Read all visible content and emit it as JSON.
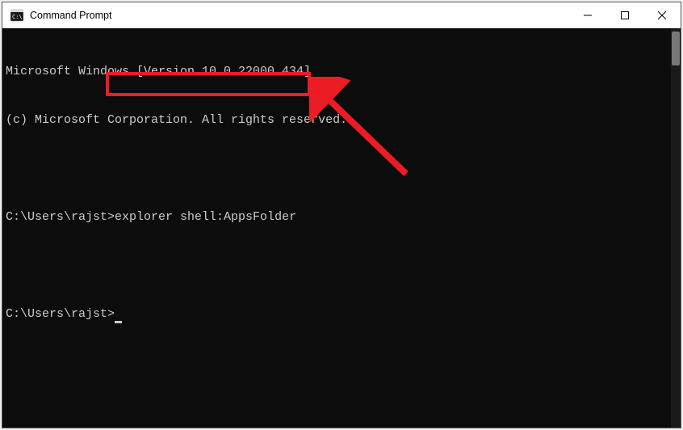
{
  "titlebar": {
    "title": "Command Prompt"
  },
  "terminal": {
    "banner_line1": "Microsoft Windows [Version 10.0.22000.434]",
    "banner_line2": "(c) Microsoft Corporation. All rights reserved.",
    "prompt1": "C:\\Users\\rajst>",
    "command1": "explorer shell:AppsFolder",
    "prompt2": "C:\\Users\\rajst>"
  },
  "annotation": {
    "highlighted_text": "explorer shell:AppsFolder"
  }
}
